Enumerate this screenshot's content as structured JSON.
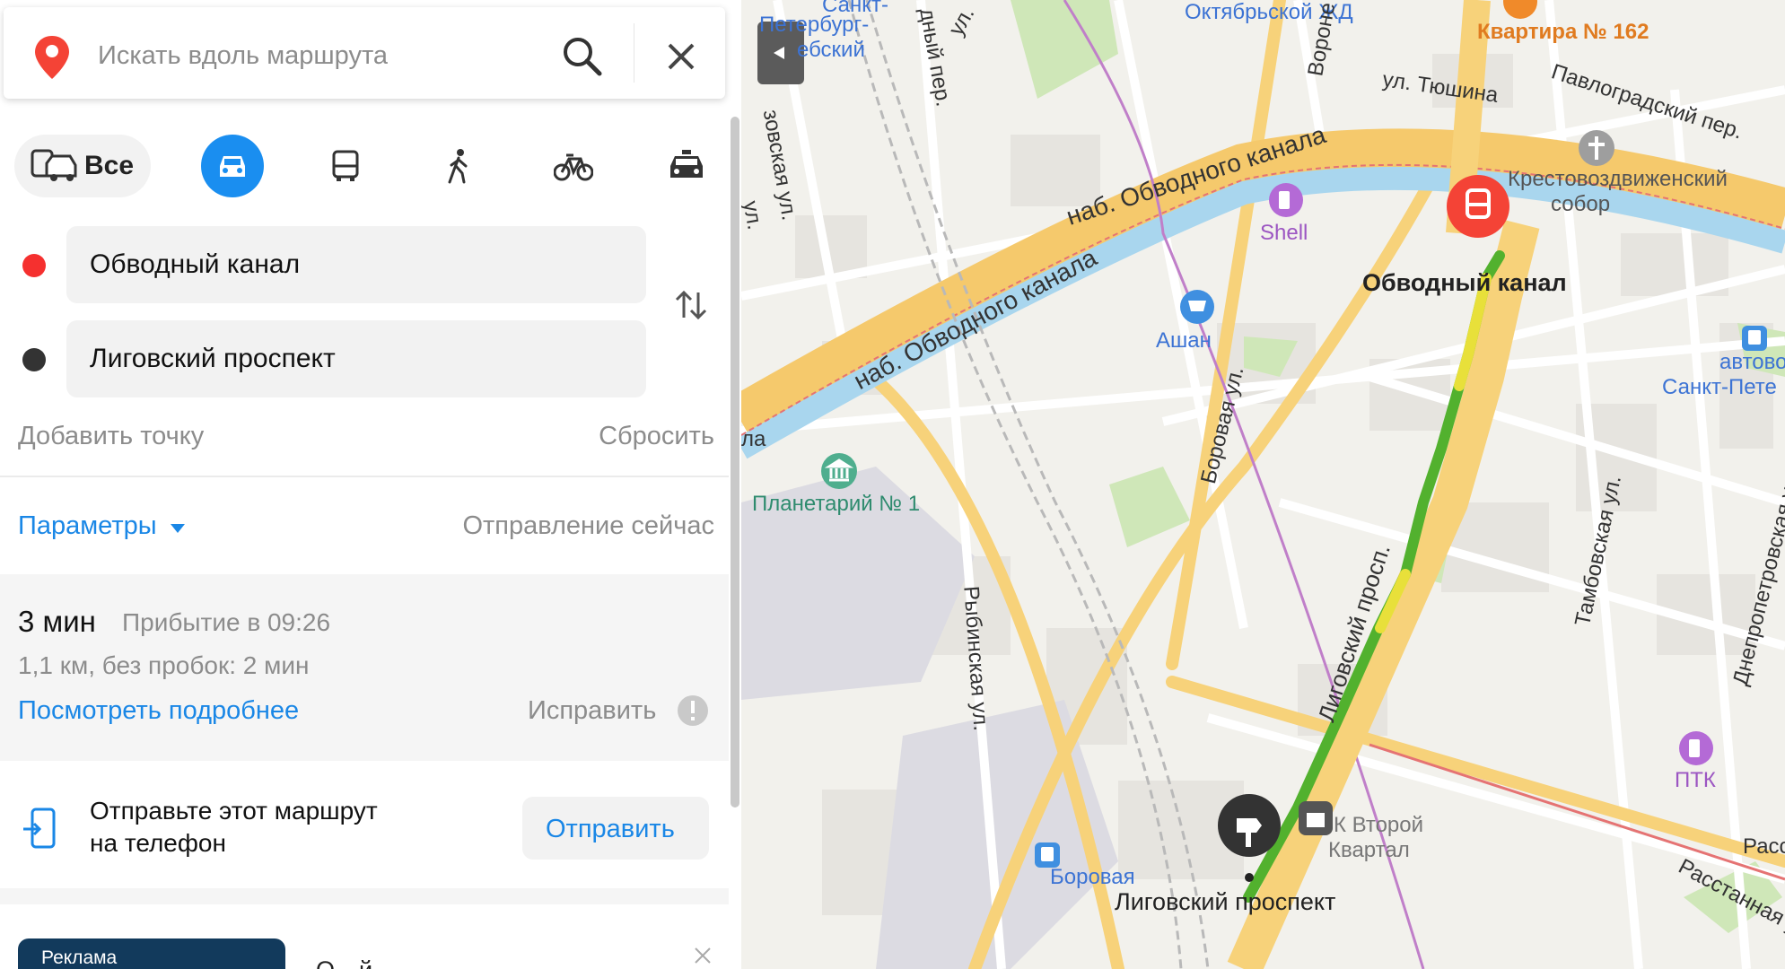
{
  "search": {
    "placeholder": "Искать вдоль маршрута"
  },
  "modes": {
    "all_label": "Все"
  },
  "points": {
    "from": "Обводный канал",
    "to": "Лиговский проспект"
  },
  "actions": {
    "add_point": "Добавить точку",
    "reset": "Сбросить"
  },
  "params": {
    "label": "Параметры",
    "departure": "Отправление сейчас"
  },
  "route": {
    "duration": "3 мин",
    "arrival": "Прибытие в 09:26",
    "details": "1,1 км, без пробок: 2 мин",
    "more_link": "Посмотреть подробнее",
    "fix_label": "Исправить"
  },
  "send": {
    "line1": "Отправьте этот маршрут",
    "line2": "на телефон",
    "button": "Отправить"
  },
  "ad": {
    "badge": "Реклама",
    "text": "О…й"
  },
  "map": {
    "labels": {
      "oktyabrskaya": "Октябрьской ЖД",
      "kvartira": "Квартира № 162",
      "tyushina": "ул. Тюшина",
      "pavlogradsky": "Павлоградский пер.",
      "sobor": "Крестовоздвиженский",
      "sobor2": "собор",
      "obvodny_emb": "наб. Обводного канала",
      "obvodny_emb2": "наб. Обводного канала",
      "shell": "Shell",
      "ashan": "Ашан",
      "obvodny_metro": "Обводный канал",
      "avtovokzal": "автовок",
      "avtovokzal2": "Санкт-Пете",
      "planetarium": "Планетарий № 1",
      "borovaya_ul": "Боровая ул.",
      "rybinskaya": "Рыбинская ул.",
      "ligovsky_pr": "Лиговский просп.",
      "tambovskaya": "Тамбовская ул.",
      "dnepropetrovskaya": "Днепропетровская ул.",
      "ptk": "ПТК",
      "vtoroy": "К Второй",
      "kvartal": "Квартал",
      "borovaya_stop": "Боровая",
      "ligovsky_end": "Лиговский проспект",
      "rasstannaya": "Расстанная ул.",
      "rass": "Расс",
      "peterburg1": "Санкт-",
      "peterburg2": "Петербург-",
      "peterburg3": "ебский",
      "ul_top": "ул.",
      "sednoy": "дный пер.",
      "voron": "Вороне",
      "zovskaya": "зовская ул.",
      "ul_left": "ул.",
      "la": "ла"
    }
  }
}
